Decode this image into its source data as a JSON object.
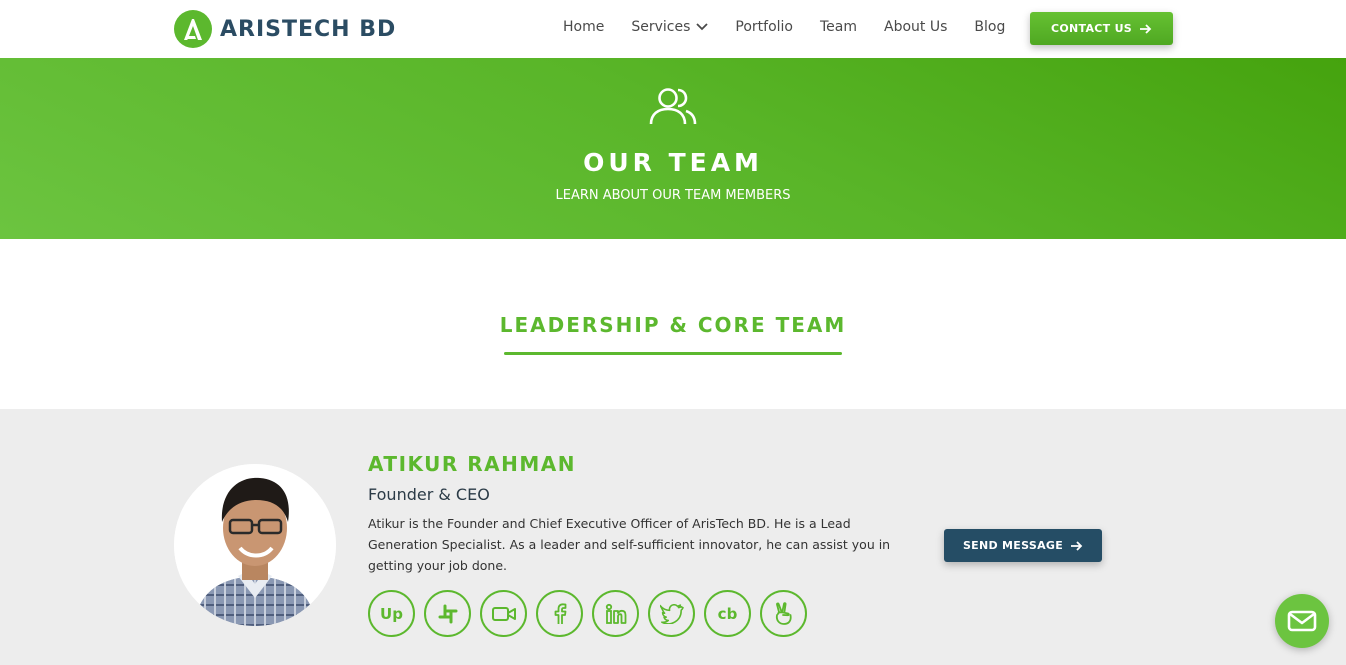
{
  "header": {
    "brand": "ARISTECH BD",
    "nav": [
      {
        "label": "Home"
      },
      {
        "label": "Services",
        "has_dropdown": true
      },
      {
        "label": "Portfolio"
      },
      {
        "label": "Team"
      },
      {
        "label": "About Us"
      },
      {
        "label": "Blog"
      }
    ],
    "contact_label": "CONTACT US"
  },
  "hero": {
    "icon": "users-icon",
    "title": "OUR TEAM",
    "subtitle": "LEARN ABOUT OUR TEAM MEMBERS"
  },
  "section": {
    "heading": "LEADERSHIP & CORE TEAM"
  },
  "member": {
    "name": "ATIKUR RAHMAN",
    "role": "Founder & CEO",
    "bio": "Atikur is the Founder and Chief Executive Officer of ArisTech BD. He is a Lead Generation Specialist. As a leader and self-sufficient innovator, he can assist you in getting your job done.",
    "send_label": "SEND MESSAGE",
    "socials": [
      {
        "icon": "upwork-icon",
        "text": "Up"
      },
      {
        "icon": "slack-icon"
      },
      {
        "icon": "video-icon"
      },
      {
        "icon": "facebook-icon"
      },
      {
        "icon": "linkedin-icon"
      },
      {
        "icon": "twitter-icon"
      },
      {
        "icon": "crunchbase-icon",
        "text": "cb"
      },
      {
        "icon": "angellist-icon"
      }
    ]
  },
  "colors": {
    "brand_green": "#5cb82e",
    "navy": "#254d65",
    "band_gray": "#ededed"
  },
  "chat": {
    "icon": "mail-icon"
  }
}
